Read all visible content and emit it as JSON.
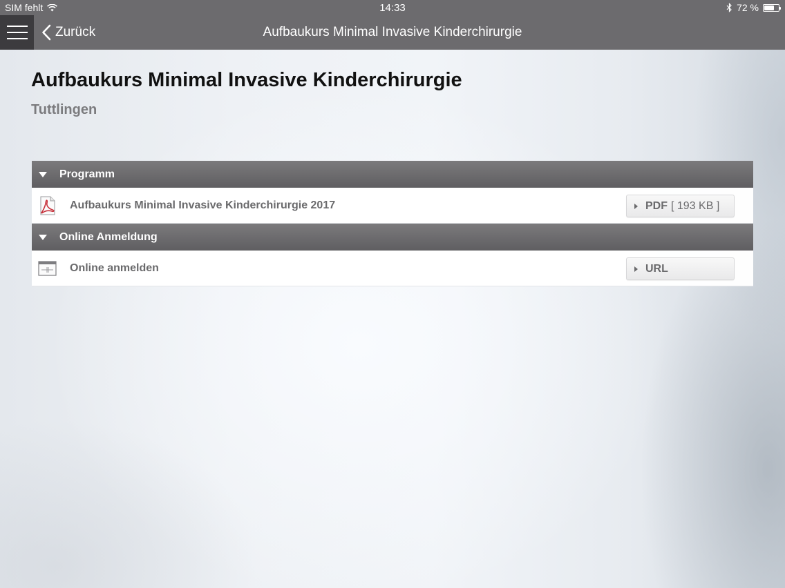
{
  "status_bar": {
    "carrier": "SIM fehlt",
    "time": "14:33",
    "battery_text": "72 %",
    "battery_level": 0.72
  },
  "nav": {
    "back_label": "Zurück",
    "title": "Aufbaukurs Minimal Invasive Kinderchirurgie"
  },
  "page": {
    "title": "Aufbaukurs Minimal Invasive Kinderchirurgie",
    "subtitle": "Tuttlingen"
  },
  "sections": [
    {
      "header": "Programm",
      "item": {
        "label": "Aufbaukurs Minimal Invasive Kinderchirurgie 2017",
        "icon": "pdf-icon",
        "button_label": "PDF",
        "button_detail": "[ 193 KB ]"
      }
    },
    {
      "header": "Online Anmeldung",
      "item": {
        "label": "Online anmelden",
        "icon": "web-form-icon",
        "button_label": "URL",
        "button_detail": ""
      }
    }
  ],
  "colors": {
    "nav_bg": "#6c6b6e",
    "menu_bg": "#3c3b3e",
    "pdf_red": "#c8323c"
  }
}
